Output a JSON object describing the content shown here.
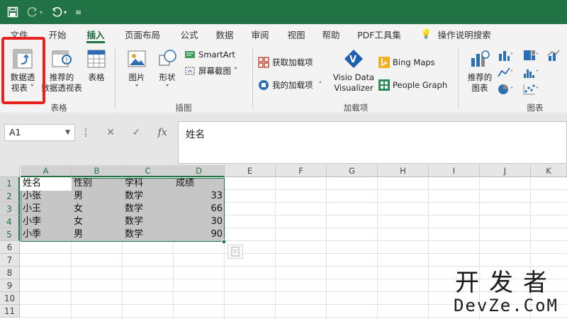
{
  "titlebar": {
    "save_icon": "save-icon",
    "redo_icon": "redo-icon",
    "undo_icon": "undo-icon",
    "customize_icon": "customize-qat-icon"
  },
  "tabs": [
    {
      "label": "文件",
      "active": false
    },
    {
      "label": "开始",
      "active": false
    },
    {
      "label": "插入",
      "active": true
    },
    {
      "label": "页面布局",
      "active": false
    },
    {
      "label": "公式",
      "active": false
    },
    {
      "label": "数据",
      "active": false
    },
    {
      "label": "审阅",
      "active": false
    },
    {
      "label": "视图",
      "active": false
    },
    {
      "label": "帮助",
      "active": false
    },
    {
      "label": "PDF工具集",
      "active": false
    },
    {
      "label": "操作说明搜索",
      "active": false
    }
  ],
  "ribbon": {
    "tables": {
      "label": "表格",
      "pivot_line1": "数据透",
      "pivot_line2": "视表 ˅",
      "recommended_line1": "推荐的",
      "recommended_line2": "数据透视表",
      "table": "表格"
    },
    "illustrations": {
      "label": "插图",
      "pictures": "图片",
      "shapes": "形状",
      "smartart": "SmartArt",
      "screenshot": "屏幕截图 ˅"
    },
    "addins": {
      "label": "加载项",
      "get_addins": "获取加载项",
      "my_addins": "我的加载项",
      "visio_line1": "Visio Data",
      "visio_line2": "Visualizer",
      "bing_maps": "Bing Maps",
      "people_graph": "People Graph"
    },
    "charts": {
      "label": "图表",
      "recommended_line1": "推荐的",
      "recommended_line2": "图表"
    }
  },
  "formula_bar": {
    "name_box": "A1",
    "fx": "fx",
    "content": "姓名"
  },
  "sheet": {
    "columns": [
      "A",
      "B",
      "C",
      "D",
      "E",
      "F",
      "G",
      "H",
      "I",
      "J",
      "K"
    ],
    "rows": [
      "1",
      "2",
      "3",
      "4",
      "5",
      "6",
      "7",
      "8",
      "9",
      "10",
      "11"
    ],
    "header": [
      "姓名",
      "性别",
      "学科",
      "成绩"
    ],
    "data": [
      [
        "小张",
        "男",
        "数学",
        "33"
      ],
      [
        "小王",
        "女",
        "数学",
        "66"
      ],
      [
        "小李",
        "女",
        "数学",
        "30"
      ],
      [
        "小季",
        "男",
        "数学",
        "90"
      ]
    ]
  },
  "watermark": {
    "line1": "开发者",
    "line2": "DevZe.CoM"
  },
  "colors": {
    "accent": "#217346",
    "highlight": "#e8221f"
  }
}
